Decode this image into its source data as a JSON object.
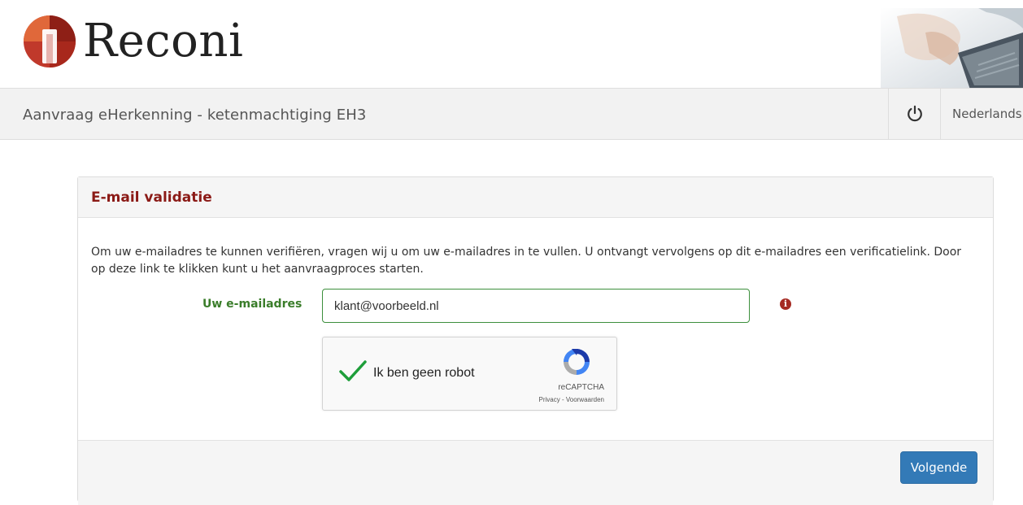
{
  "brand": {
    "name": "Reconi",
    "logo_icon": "reconi-logo-icon",
    "accent": "#c0392b"
  },
  "header": {
    "photo": "laptop-hands-photo"
  },
  "titlebar": {
    "title": "Aanvraag eHerkenning - ketenmachtiging EH3",
    "power_icon": "power-icon",
    "language": "Nederlands"
  },
  "panel": {
    "title": "E-mail validatie",
    "intro": "Om uw e-mailadres te kunnen verifiëren, vragen wij u om uw e-mailadres in te vullen. U ontvangt vervolgens op dit e-mailadres een verificatielink. Door op deze link te klikken kunt u het aanvraagproces starten.",
    "email_label": "Uw e-mailadres",
    "email_value": "klant@voorbeeld.nl",
    "info_icon": "info-icon",
    "info_glyph": "i"
  },
  "captcha": {
    "checked": true,
    "label": "Ik ben geen robot",
    "brand": "reCAPTCHA",
    "links": "Privacy - Voorwaarden"
  },
  "footer": {
    "next_label": "Volgende",
    "button_color": "#337ab7"
  }
}
